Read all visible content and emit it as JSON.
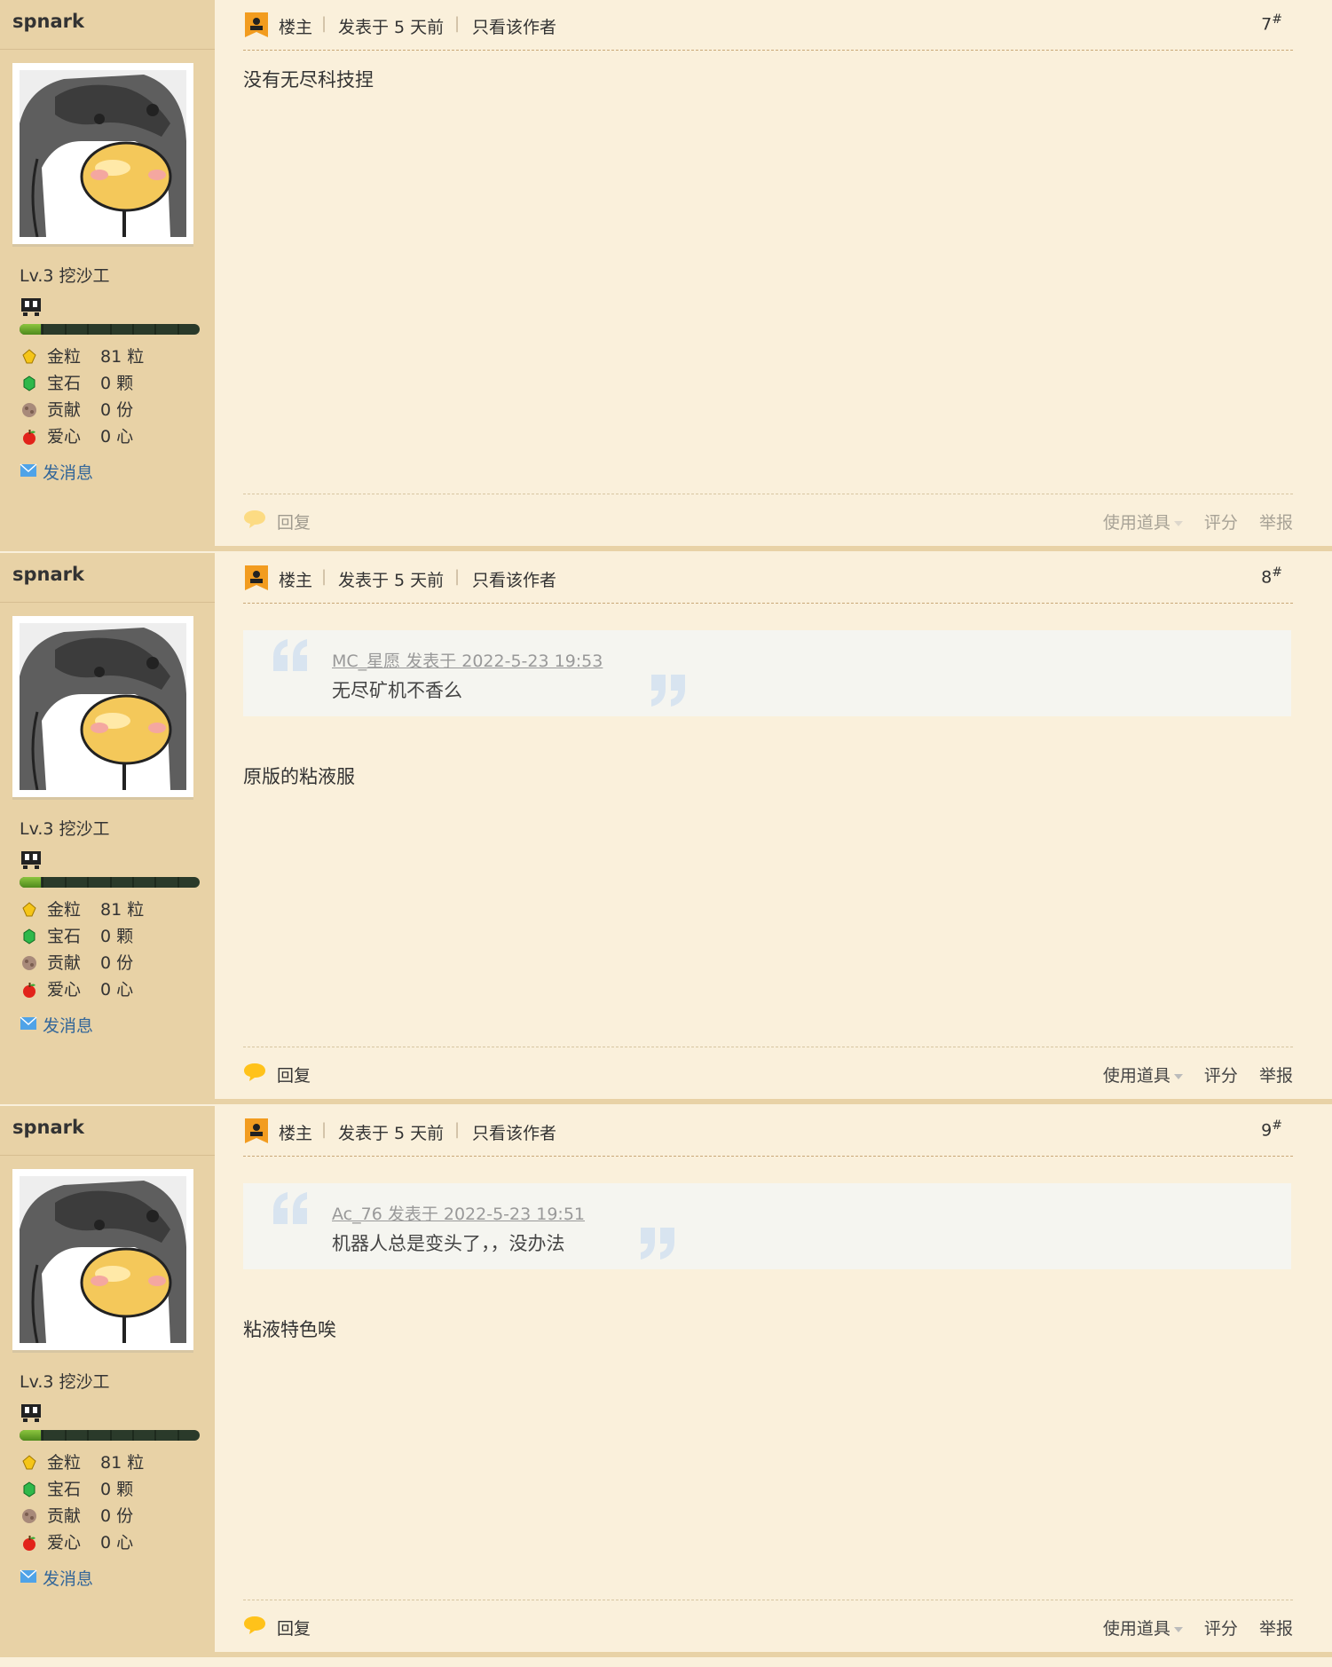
{
  "colors": {
    "page_bg": "#FAF0DB",
    "sidebar_bg": "#E8D2A6",
    "accent_orange": "#F29C1F",
    "link_blue": "#336699"
  },
  "posts": [
    {
      "author": "spnark",
      "level": "Lv.3 挖沙工",
      "exp_fraction": 0.12,
      "stats": [
        {
          "icon": "gold-nugget-icon",
          "label": "金粒",
          "value": "81 粒"
        },
        {
          "icon": "emerald-icon",
          "label": "宝石",
          "value": "0 颗"
        },
        {
          "icon": "contribution-icon",
          "label": "贡献",
          "value": "0 份"
        },
        {
          "icon": "apple-heart-icon",
          "label": "爱心",
          "value": "0 心"
        }
      ],
      "send_message": "发消息",
      "op_label": "楼主",
      "posted": "发表于 5 天前",
      "only_author": "只看该作者",
      "floor": "7",
      "floor_mark": "#",
      "content": "没有无尽科技捏",
      "quote": null,
      "reply": "回复",
      "use_item": "使用道具",
      "rate": "评分",
      "report": "举报"
    },
    {
      "author": "spnark",
      "level": "Lv.3 挖沙工",
      "exp_fraction": 0.12,
      "stats": [
        {
          "icon": "gold-nugget-icon",
          "label": "金粒",
          "value": "81 粒"
        },
        {
          "icon": "emerald-icon",
          "label": "宝石",
          "value": "0 颗"
        },
        {
          "icon": "contribution-icon",
          "label": "贡献",
          "value": "0 份"
        },
        {
          "icon": "apple-heart-icon",
          "label": "爱心",
          "value": "0 心"
        }
      ],
      "send_message": "发消息",
      "op_label": "楼主",
      "posted": "发表于 5 天前",
      "only_author": "只看该作者",
      "floor": "8",
      "floor_mark": "#",
      "content": "原版的粘液服",
      "quote": {
        "author": "MC_星愿 发表于 2022-5-23 19:53",
        "text": "无尽矿机不香么"
      },
      "reply": "回复",
      "use_item": "使用道具",
      "rate": "评分",
      "report": "举报"
    },
    {
      "author": "spnark",
      "level": "Lv.3 挖沙工",
      "exp_fraction": 0.12,
      "stats": [
        {
          "icon": "gold-nugget-icon",
          "label": "金粒",
          "value": "81 粒"
        },
        {
          "icon": "emerald-icon",
          "label": "宝石",
          "value": "0 颗"
        },
        {
          "icon": "contribution-icon",
          "label": "贡献",
          "value": "0 份"
        },
        {
          "icon": "apple-heart-icon",
          "label": "爱心",
          "value": "0 心"
        }
      ],
      "send_message": "发消息",
      "op_label": "楼主",
      "posted": "发表于 5 天前",
      "only_author": "只看该作者",
      "floor": "9",
      "floor_mark": "#",
      "content": "粘液特色唉",
      "quote": {
        "author": "Ac_76 发表于 2022-5-23 19:51",
        "text": "机器人总是变头了，，没办法"
      },
      "reply": "回复",
      "use_item": "使用道具",
      "rate": "评分",
      "report": "举报"
    }
  ]
}
